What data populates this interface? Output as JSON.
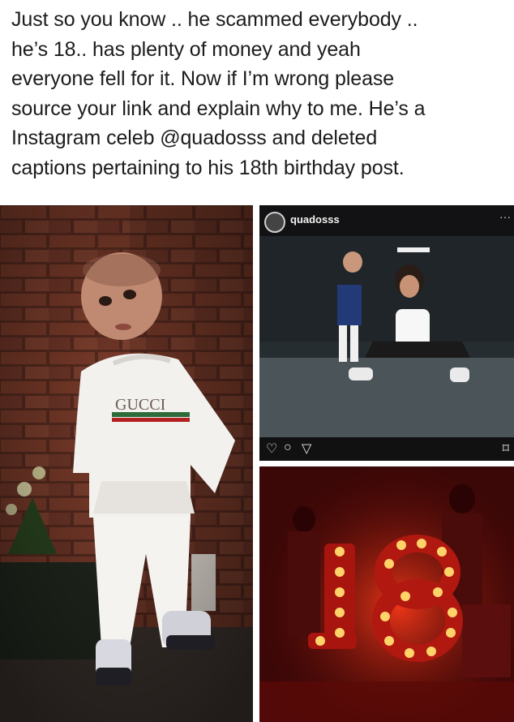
{
  "post": {
    "lines": [
      "Just so you know .. he scammed everybody ..",
      "he’s 18.. has plenty of money and yeah",
      "everyone fell for it. Now if I’m wrong please",
      "source your link and explain why to me. He’s a",
      "Instagram celeb @quadosss and deleted",
      "captions pertaining to his 18th birthday post."
    ]
  },
  "left_photo": {
    "hoodie_text": "GUCCI"
  },
  "instagram": {
    "username": "quadosss",
    "more_icon": "ellipsis-icon",
    "actions": [
      "heart-icon",
      "comment-icon",
      "share-icon",
      "bookmark-icon"
    ]
  },
  "party_photo": {
    "sign_text": "18"
  },
  "colors": {
    "caption_text": "#1c1c1c",
    "brick": "#7a3b2a",
    "party_red": "#d51a10",
    "bulb": "#ffd36a"
  }
}
